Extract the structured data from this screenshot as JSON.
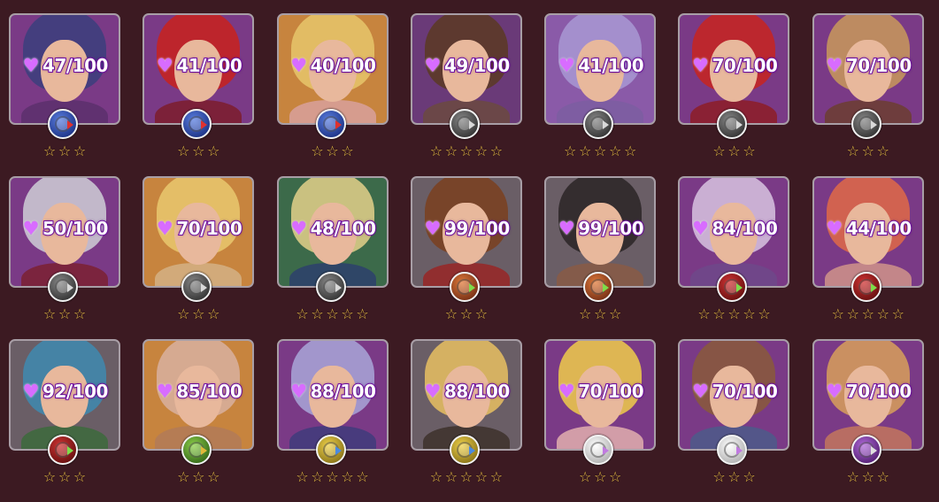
{
  "colors": {
    "page_bg": "#3c1a22",
    "card_border": "#a89ea6",
    "star": "#f3c24b",
    "affection_text_outline": "#7c0fb3",
    "affection_heart": "#d86cff"
  },
  "icons": {
    "affection": "heart-gem-icon",
    "star": "empty-star-icon"
  },
  "girls": [
    {
      "affection": "47/100",
      "stars": 3,
      "element": "blue",
      "bg": "#7a3a86",
      "hair": "#3b3f7c",
      "body": "#5a2f6a"
    },
    {
      "affection": "41/100",
      "stars": 3,
      "element": "blue",
      "bg": "#7a3a86",
      "hair": "#c9221c",
      "body": "#7d1c25"
    },
    {
      "affection": "40/100",
      "stars": 3,
      "element": "blue",
      "bg": "#c7843e",
      "hair": "#e6c56b",
      "body": "#d9a3a3"
    },
    {
      "affection": "49/100",
      "stars": 5,
      "element": "dark",
      "bg": "#6a3a78",
      "hair": "#5a3a22",
      "body": "#6b4b3c"
    },
    {
      "affection": "41/100",
      "stars": 5,
      "element": "dark",
      "bg": "#8a5aa8",
      "hair": "#a899d4",
      "body": "#7b5ea0"
    },
    {
      "affection": "70/100",
      "stars": 3,
      "element": "dark",
      "bg": "#7a3a86",
      "hair": "#c8241f",
      "body": "#8e1b1f"
    },
    {
      "affection": "70/100",
      "stars": 3,
      "element": "dark",
      "bg": "#7a3a86",
      "hair": "#c99a5a",
      "body": "#6b3e2a"
    },
    {
      "affection": "50/100",
      "stars": 3,
      "element": "dark",
      "bg": "#7a3a86",
      "hair": "#cfcfd6",
      "body": "#7c1f2c"
    },
    {
      "affection": "70/100",
      "stars": 3,
      "element": "dark",
      "bg": "#c7843e",
      "hair": "#e9c86f",
      "body": "#d4b48a"
    },
    {
      "affection": "48/100",
      "stars": 5,
      "element": "dark",
      "bg": "#3c6a4a",
      "hair": "#e3d08a",
      "body": "#2c3d6e"
    },
    {
      "affection": "99/100",
      "stars": 3,
      "element": "orange",
      "bg": "#6a5e66",
      "hair": "#7a3f1f",
      "body": "#9b2222"
    },
    {
      "affection": "99/100",
      "stars": 3,
      "element": "orange",
      "bg": "#6a5e66",
      "hair": "#2a2426",
      "body": "#8b5a44"
    },
    {
      "affection": "84/100",
      "stars": 5,
      "element": "red",
      "bg": "#7a3a86",
      "hair": "#d8c4e0",
      "body": "#6e4a8a"
    },
    {
      "affection": "44/100",
      "stars": 5,
      "element": "red",
      "bg": "#7a3a86",
      "hair": "#e06a46",
      "body": "#d69a8a"
    },
    {
      "affection": "92/100",
      "stars": 3,
      "element": "red",
      "bg": "#6a5e66",
      "hair": "#3e8ab0",
      "body": "#3a6a3a"
    },
    {
      "affection": "85/100",
      "stars": 3,
      "element": "green",
      "bg": "#c7843e",
      "hair": "#d8b0a0",
      "body": "#b07a5a"
    },
    {
      "affection": "88/100",
      "stars": 5,
      "element": "yellow",
      "bg": "#7a3a86",
      "hair": "#a9a7d8",
      "body": "#3c3c7a"
    },
    {
      "affection": "88/100",
      "stars": 5,
      "element": "yellow",
      "bg": "#6a5e66",
      "hair": "#e8c061",
      "body": "#3b2e28"
    },
    {
      "affection": "70/100",
      "stars": 3,
      "element": "white",
      "bg": "#7a3a86",
      "hair": "#f0cc4a",
      "body": "#e8b6b0"
    },
    {
      "affection": "70/100",
      "stars": 3,
      "element": "white",
      "bg": "#7a3a86",
      "hair": "#8a5a3a",
      "body": "#4a5e8a"
    },
    {
      "affection": "70/100",
      "stars": 3,
      "element": "purple",
      "bg": "#7a3a86",
      "hair": "#d8a05a",
      "body": "#c87a5a"
    }
  ]
}
